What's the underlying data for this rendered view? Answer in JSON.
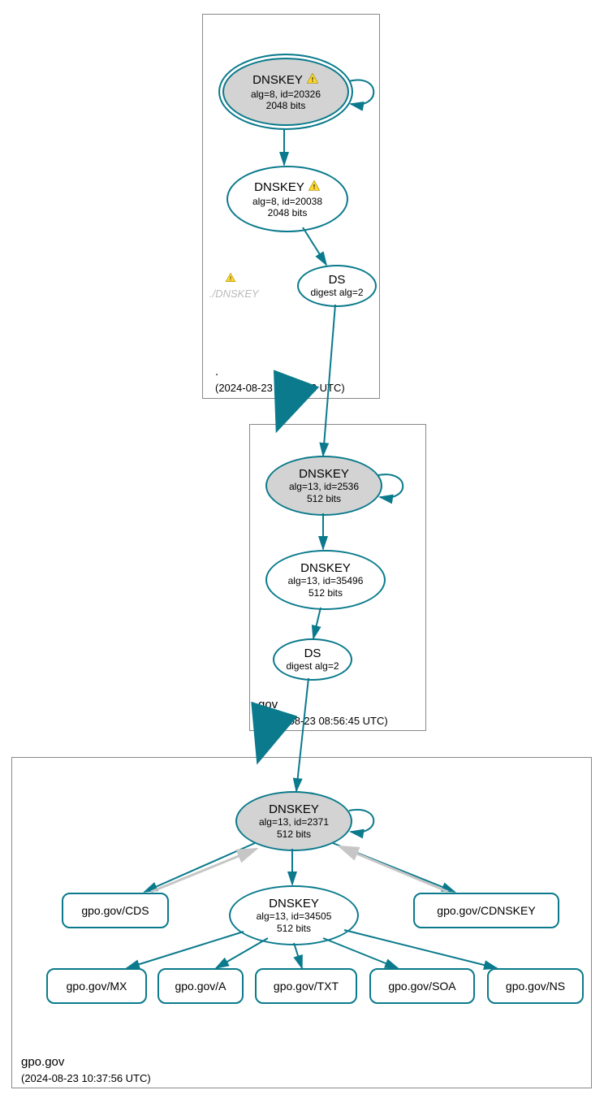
{
  "zones": {
    "root": {
      "name": ".",
      "timestamp": "(2024-08-23 06:40:13 UTC)",
      "ksk": {
        "title": "DNSKEY",
        "warn": true,
        "line1": "alg=8, id=20326",
        "line2": "2048 bits"
      },
      "zsk": {
        "title": "DNSKEY",
        "warn": true,
        "line1": "alg=8, id=20038",
        "line2": "2048 bits"
      },
      "ds": {
        "title": "DS",
        "line1": "digest alg=2"
      },
      "faded_label": "./DNSKEY"
    },
    "gov": {
      "name": "gov",
      "timestamp": "(2024-08-23 08:56:45 UTC)",
      "ksk": {
        "title": "DNSKEY",
        "line1": "alg=13, id=2536",
        "line2": "512 bits"
      },
      "zsk": {
        "title": "DNSKEY",
        "line1": "alg=13, id=35496",
        "line2": "512 bits"
      },
      "ds": {
        "title": "DS",
        "line1": "digest alg=2"
      }
    },
    "gpo": {
      "name": "gpo.gov",
      "timestamp": "(2024-08-23 10:37:56 UTC)",
      "ksk": {
        "title": "DNSKEY",
        "line1": "alg=13, id=2371",
        "line2": "512 bits"
      },
      "zsk": {
        "title": "DNSKEY",
        "line1": "alg=13, id=34505",
        "line2": "512 bits"
      },
      "records": {
        "cds": "gpo.gov/CDS",
        "cdnskey": "gpo.gov/CDNSKEY",
        "mx": "gpo.gov/MX",
        "a": "gpo.gov/A",
        "txt": "gpo.gov/TXT",
        "soa": "gpo.gov/SOA",
        "ns": "gpo.gov/NS"
      }
    }
  }
}
